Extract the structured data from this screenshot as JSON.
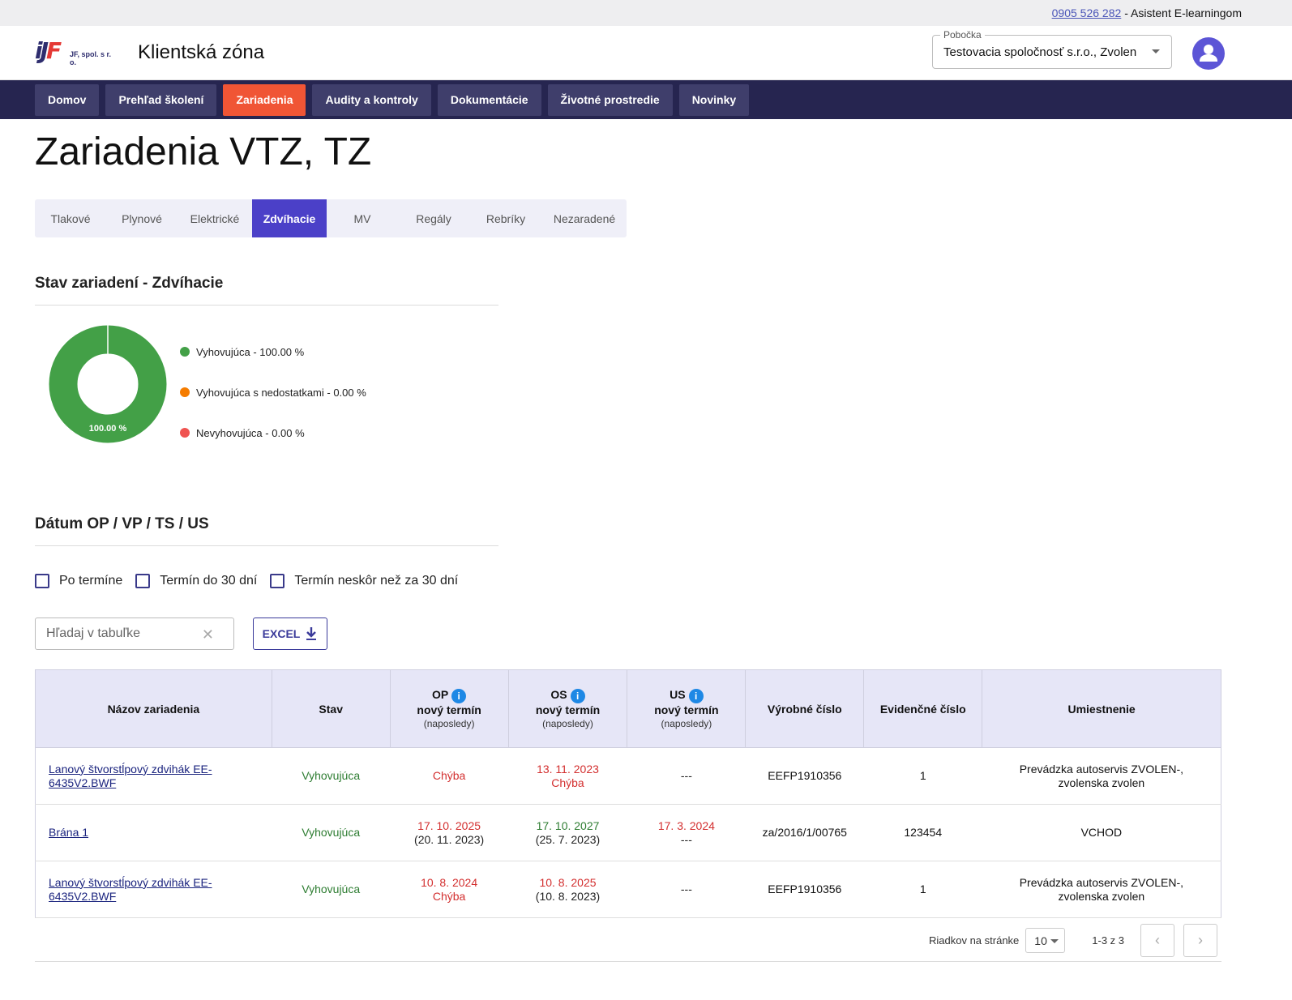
{
  "topbar": {
    "phone": "0905 526 282",
    "assistant": "- Asistent E-learningom"
  },
  "header": {
    "logo_mark_a": "iJ",
    "logo_mark_b": "F",
    "logo_sub": "JF, spol. s r. o.",
    "title": "Klientská zóna",
    "branch_label": "Pobočka",
    "branch_value": "Testovacia spoločnosť s.r.o., Zvolen"
  },
  "nav": [
    "Domov",
    "Prehľad školení",
    "Zariadenia",
    "Audity a kontroly",
    "Dokumentácie",
    "Životné prostredie",
    "Novinky"
  ],
  "page_title": "Zariadenia VTZ, TZ",
  "tabs": [
    "Tlakové",
    "Plynové",
    "Elektrické",
    "Zdvíhacie",
    "MV",
    "Regály",
    "Rebríky",
    "Nezaradené"
  ],
  "status_section": {
    "title": "Stav zariadení - Zdvíhacie",
    "donut_label": "100.00 %",
    "legend": [
      {
        "label": "Vyhovujúca - 100.00 %",
        "color": "#43a047",
        "value": 100
      },
      {
        "label": "Vyhovujúca s nedostatkami - 0.00 %",
        "color": "#f57c00",
        "value": 0
      },
      {
        "label": "Nevyhovujúca - 0.00 %",
        "color": "#ef5350",
        "value": 0
      }
    ]
  },
  "date_section": {
    "title": "Dátum OP / VP / TS / US",
    "filters": [
      "Po termíne",
      "Termín do 30 dní",
      "Termín neskôr než za 30 dní"
    ]
  },
  "search": {
    "placeholder": "Hľadaj v tabuľke",
    "clear": "✕"
  },
  "excel_label": "EXCEL",
  "table": {
    "headers": {
      "name": "Názov zariadenia",
      "status": "Stav",
      "op": "OP",
      "os": "OS",
      "us": "US",
      "new_term": "nový termín",
      "last": "(naposledy)",
      "serial": "Výrobné číslo",
      "evidence": "Evidenčné číslo",
      "location": "Umiestnenie"
    },
    "info_glyph": "i",
    "rows": [
      {
        "name": "Lanový  štvorstĺpový zdvihák EE-6435V2.BWF",
        "status": "Vyhovujúca",
        "op_line1": "Chýba",
        "op_line1_class": "bad",
        "op_line2": "",
        "op_line2_class": "bad",
        "os_line1": "13. 11. 2023",
        "os_line1_class": "bad",
        "os_line2": "Chýba",
        "os_line2_class": "bad",
        "us_line1": "---",
        "us_line1_class": "norm",
        "us_line2": "",
        "us_line2_class": "norm",
        "serial": "EEFP1910356",
        "evidence": "1",
        "location": "Prevádzka autoservis ZVOLEN-, zvolenska zvolen"
      },
      {
        "name": "Brána 1",
        "status": "Vyhovujúca",
        "op_line1": "17. 10. 2025",
        "op_line1_class": "bad",
        "op_line2": "(20. 11. 2023)",
        "op_line2_class": "norm",
        "os_line1": "17. 10. 2027",
        "os_line1_class": "ok",
        "os_line2": "(25. 7. 2023)",
        "os_line2_class": "norm",
        "us_line1": "17. 3. 2024",
        "us_line1_class": "bad",
        "us_line2": "---",
        "us_line2_class": "norm",
        "serial": "za/2016/1/00765",
        "evidence": "123454",
        "location": "VCHOD"
      },
      {
        "name": "Lanový  štvorstĺpový zdvihák EE-6435V2.BWF",
        "status": "Vyhovujúca",
        "op_line1": "10. 8. 2024",
        "op_line1_class": "bad",
        "op_line2": "Chýba",
        "op_line2_class": "bad",
        "os_line1": "10. 8. 2025",
        "os_line1_class": "bad",
        "os_line2": "(10. 8. 2023)",
        "os_line2_class": "norm",
        "us_line1": "---",
        "us_line1_class": "norm",
        "us_line2": "",
        "us_line2_class": "norm",
        "serial": "EEFP1910356",
        "evidence": "1",
        "location": "Prevádzka autoservis ZVOLEN-, zvolenska zvolen"
      }
    ]
  },
  "pagination": {
    "rows_label": "Riadkov na stránke",
    "rows_value": "10",
    "range": "1-3 z 3",
    "prev": "‹",
    "next": "›"
  },
  "colors": {
    "nav_bg": "#262550",
    "active_nav": "#f05535",
    "active_tab": "#4b40c8",
    "ok": "#2e7d32",
    "bad": "#d32f2f"
  }
}
